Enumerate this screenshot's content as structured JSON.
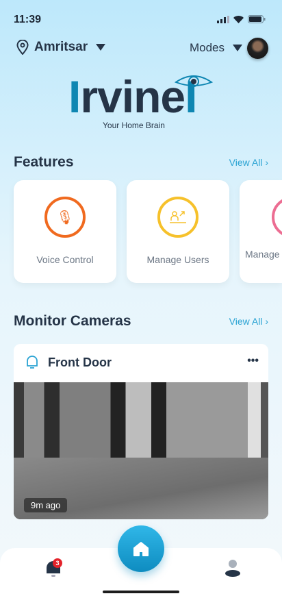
{
  "status_bar": {
    "time": "11:39"
  },
  "header": {
    "location": "Amritsar",
    "modes_label": "Modes"
  },
  "logo": {
    "brand": "Irvinei",
    "tagline": "Your Home Brain"
  },
  "features": {
    "title": "Features",
    "view_all": "View All",
    "items": [
      {
        "label": "Voice Control",
        "icon": "microphone-icon",
        "color": "#f06a1f"
      },
      {
        "label": "Manage Users",
        "icon": "users-icon",
        "color": "#f6c12b"
      },
      {
        "label": "Manage",
        "icon": "feature-icon",
        "color": "#ec6d92"
      }
    ]
  },
  "cameras": {
    "title": "Monitor Cameras",
    "view_all": "View All",
    "items": [
      {
        "name": "Front Door",
        "more": "•••",
        "time_ago": "9m ago"
      }
    ]
  },
  "nav": {
    "notification_count": "3"
  }
}
